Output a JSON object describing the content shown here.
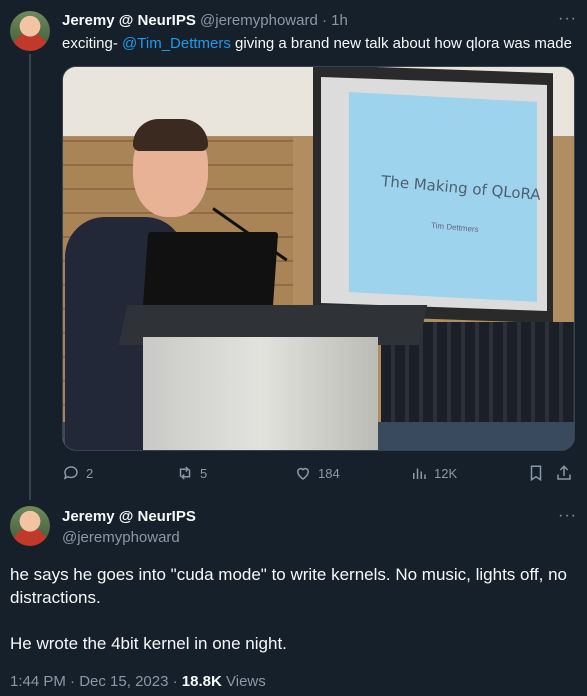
{
  "tweet1": {
    "author_name": "Jeremy @ NeurIPS",
    "author_handle": "@jeremyphoward",
    "separator": "·",
    "time": "1h",
    "text_prefix": "exciting- ",
    "mention": "@Tim_Dettmers",
    "text_suffix": " giving a brand new talk about how qlora was made",
    "media": {
      "slide_title": "The Making of QLoRA",
      "slide_subtitle": "Tim Dettmers"
    },
    "actions": {
      "replies": "2",
      "reposts": "5",
      "likes": "184",
      "views": "12K"
    }
  },
  "tweet2": {
    "author_name": "Jeremy @ NeurIPS",
    "author_handle": "@jeremyphoward",
    "paragraphs": [
      "he says he goes into \"cuda mode\" to write kernels. No music, lights off, no distractions.",
      "He wrote the 4bit kernel in one night."
    ],
    "time": "1:44 PM",
    "separator": "·",
    "date": "Dec 15, 2023",
    "views_count": "18.8K",
    "views_label": "Views"
  },
  "colors": {
    "background": "#15202b",
    "text_primary": "#f7f9f9",
    "text_muted": "#8b98a5",
    "link": "#1d9bf0",
    "border": "#38444d"
  },
  "icons": [
    "more-icon",
    "reply-icon",
    "repost-icon",
    "like-icon",
    "views-icon",
    "bookmark-icon",
    "share-icon"
  ]
}
